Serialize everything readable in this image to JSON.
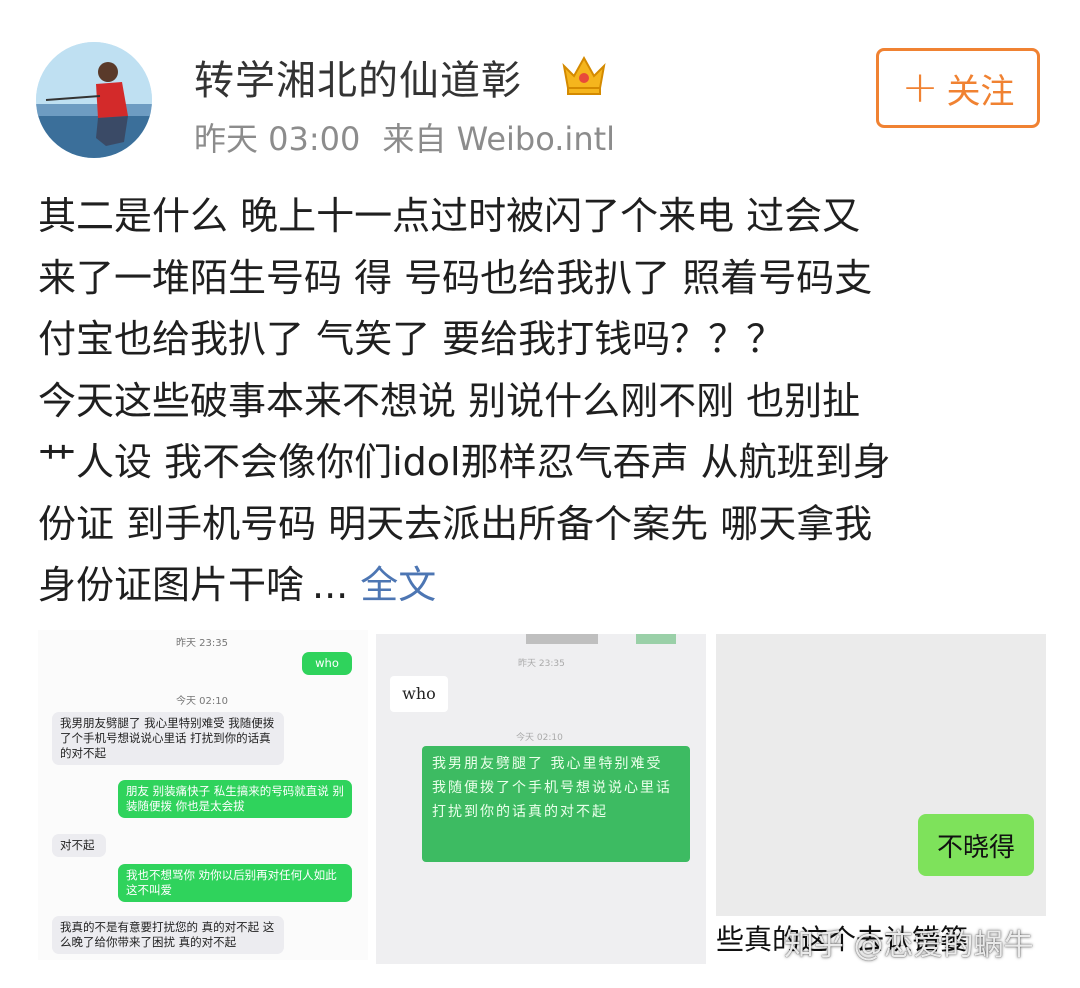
{
  "header": {
    "username": "转学湘北的仙道彰",
    "badge_icon": "crown-icon",
    "time": "昨天 03:00",
    "source": "来自 Weibo.intl",
    "follow_label": "关注",
    "follow_icon": "plus-icon"
  },
  "post": {
    "lines": [
      "其二是什么 晚上十一点过时被闪了个来电 过会又",
      "来了一堆陌生号码 得 号码也给我扒了 照着号码支",
      "付宝也给我扒了 气笑了 要给我打钱吗？？？",
      "今天这些破事本来不想说 别说什么刚不刚 也别扯",
      "艹人设 我不会像你们idol那样忍气吞声 从航班到身",
      "份证 到手机号码 明天去派出所备个案先 哪天拿我",
      "身份证图片干啥"
    ],
    "ellipsis": "...",
    "fulltext_label": "全文"
  },
  "images": [
    {
      "timestamps": [
        "昨天 23:35",
        "今天 02:10"
      ],
      "messages": [
        {
          "side": "right",
          "text": "who"
        },
        {
          "side": "left",
          "text": "我男朋友劈腿了 我心里特别难受 我随便拨了个手机号想说说心里话 打扰到你的话真的对不起"
        },
        {
          "side": "right",
          "text": "朋友 别装痛快子 私生搞来的号码就直说 别装随便拨 你也是太会拔"
        },
        {
          "side": "left",
          "text": "对不起"
        },
        {
          "side": "right",
          "text": "我也不想骂你 劝你以后别再对任何人如此 这不叫爱"
        },
        {
          "side": "left",
          "text": "我真的不是有意要打扰您的 真的对不起 这么晚了给你带来了困扰 真的对不起"
        }
      ]
    },
    {
      "time_top": "昨天 23:35",
      "time_mid": "今天 02:10",
      "messages": [
        {
          "side": "left",
          "text": "who"
        },
        {
          "side": "right",
          "text": "我男朋友劈腿了 我心里特别难受 我随便拨了个手机号想说说心里话 打扰到你的话真的对不起"
        }
      ]
    },
    {
      "bubble_text": "不晓得",
      "caption": "些真的这个去认错篓"
    }
  ],
  "watermark": "知乎 @恋爱的蜗牛"
}
